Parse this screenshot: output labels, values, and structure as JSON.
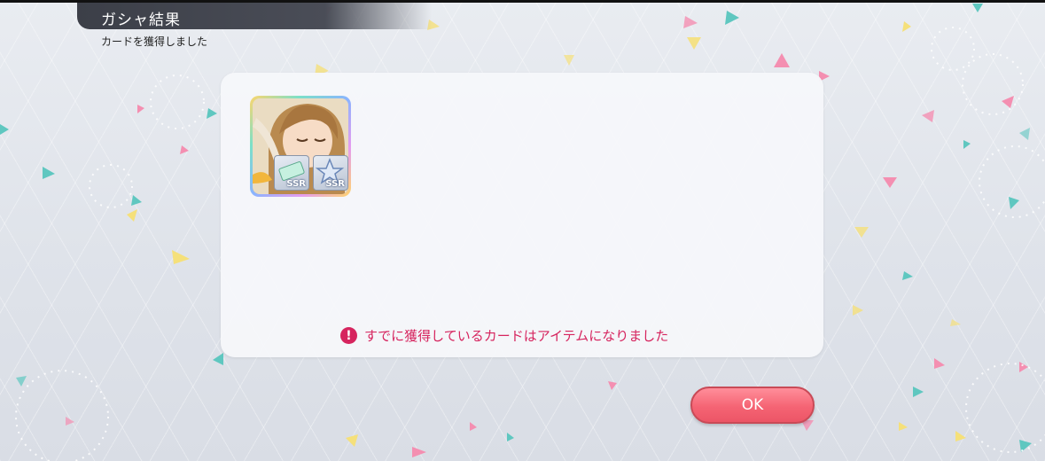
{
  "header": {
    "title": "ガシャ結果",
    "subtitle": "カードを獲得しました"
  },
  "card": {
    "badges": [
      {
        "rarity": "SSR",
        "icon": "ticket-icon"
      },
      {
        "rarity": "SSR",
        "icon": "star-icon"
      }
    ]
  },
  "notice": {
    "icon": "!",
    "text": "すでに獲得しているカードはアイテムになりました"
  },
  "buttons": {
    "ok_label": "OK"
  },
  "colors": {
    "accent": "#d6245e",
    "button": "#f56474",
    "header": "#3c3f48"
  }
}
